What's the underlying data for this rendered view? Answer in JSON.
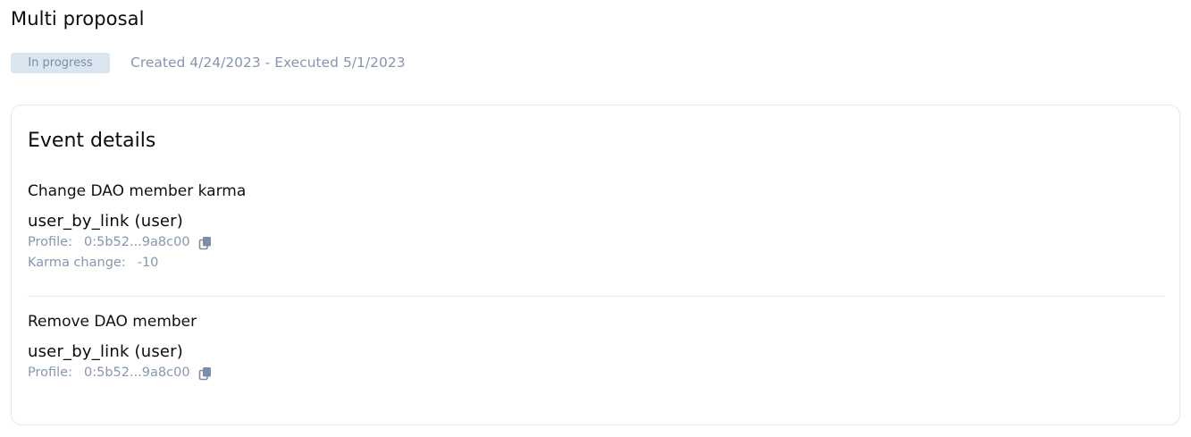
{
  "header": {
    "title": "Multi proposal",
    "status": "In progress",
    "dates": "Created 4/24/2023 - Executed 5/1/2023"
  },
  "card": {
    "title": "Event details",
    "events": [
      {
        "type": "Change DAO member karma",
        "user": "user_by_link (user)",
        "profile_label": "Profile:",
        "profile_value": "0:5b52...9a8c00",
        "karma_label": "Karma change:",
        "karma_value": "-10"
      },
      {
        "type": "Remove DAO member",
        "user": "user_by_link (user)",
        "profile_label": "Profile:",
        "profile_value": "0:5b52...9a8c00"
      }
    ]
  },
  "icons": {
    "copy": "copy-icon"
  },
  "colors": {
    "badge_bg": "#d9e5ef",
    "muted_text": "#8796b0",
    "icon": "#7b8ea8",
    "border": "#e6e8ec"
  }
}
